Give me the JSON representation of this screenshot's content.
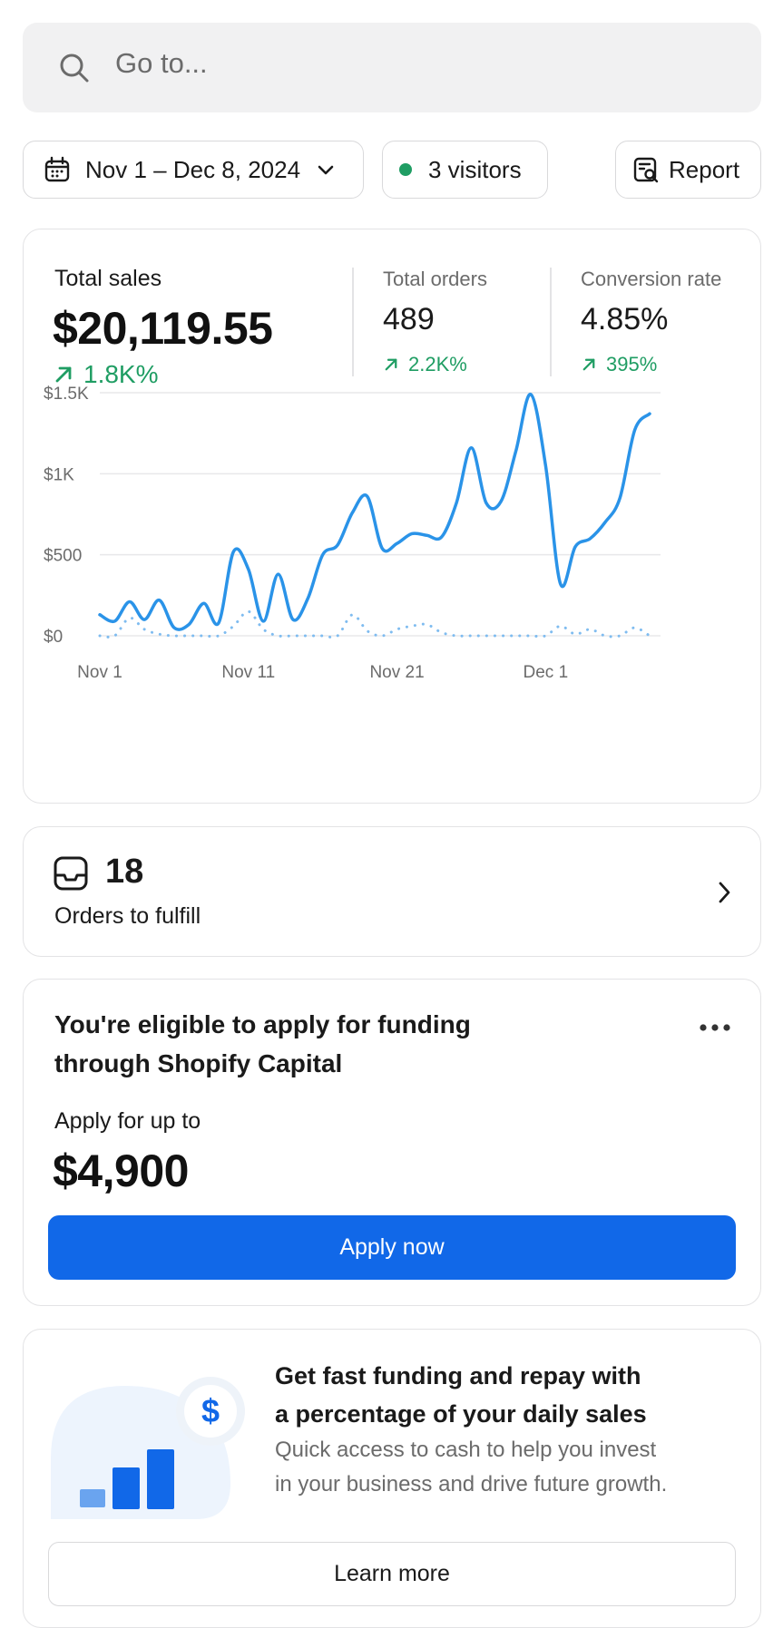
{
  "search": {
    "placeholder": "Go to..."
  },
  "filters": {
    "date_range": "Nov 1 – Dec 8, 2024",
    "visitors": "3 visitors",
    "report": "Report"
  },
  "stats": {
    "total_sales": {
      "label": "Total sales",
      "value": "$20,119.55",
      "change": "1.8K%"
    },
    "total_orders": {
      "label": "Total orders",
      "value": "489",
      "change": "2.2K%"
    },
    "conversion_rate": {
      "label": "Conversion rate",
      "value": "4.85%",
      "change": "395%"
    }
  },
  "chart_data": {
    "type": "line",
    "y_ticks": [
      "$1.5K",
      "$1K",
      "$500",
      "$0"
    ],
    "x_ticks": [
      "Nov 1",
      "Nov 11",
      "Nov 21",
      "Dec 1"
    ],
    "ylim": [
      0,
      1500
    ],
    "grid": true,
    "series": [
      {
        "style": "solid",
        "color": "#2a93e8",
        "x": [
          1,
          2,
          3,
          4,
          5,
          6,
          7,
          8,
          9,
          10,
          11,
          12,
          13,
          14,
          15,
          16,
          17,
          18,
          19,
          20,
          21,
          22,
          23,
          24,
          25,
          26,
          27,
          28,
          29,
          30,
          31,
          32,
          33,
          34,
          35,
          36,
          37,
          38
        ],
        "values": [
          130,
          90,
          210,
          100,
          220,
          50,
          70,
          200,
          80,
          520,
          410,
          90,
          380,
          100,
          230,
          500,
          560,
          760,
          860,
          540,
          570,
          630,
          620,
          610,
          820,
          1160,
          820,
          830,
          1140,
          1490,
          1050,
          320,
          550,
          600,
          700,
          850,
          1270,
          1370
        ]
      },
      {
        "style": "dotted",
        "color": "#7fbcf0",
        "x": [
          1,
          2,
          3,
          4,
          5,
          6,
          7,
          8,
          9,
          10,
          11,
          12,
          13,
          14,
          15,
          16,
          17,
          18,
          19,
          20,
          21,
          22,
          23,
          24,
          25,
          26,
          27,
          28,
          29,
          30,
          31,
          32,
          33,
          34,
          35,
          36,
          37,
          38
        ],
        "values": [
          0,
          0,
          110,
          40,
          10,
          0,
          0,
          0,
          0,
          60,
          150,
          40,
          0,
          0,
          0,
          0,
          0,
          130,
          30,
          0,
          40,
          60,
          70,
          20,
          0,
          0,
          0,
          0,
          0,
          0,
          0,
          60,
          10,
          40,
          0,
          0,
          50,
          0
        ]
      }
    ]
  },
  "orders": {
    "count": "18",
    "label": "Orders to fulfill"
  },
  "funding": {
    "title_line1": "You're eligible to apply for funding",
    "title_line2": "through Shopify Capital",
    "apply_label": "Apply for up to",
    "amount": "$4,900",
    "button": "Apply now"
  },
  "promo": {
    "title_line1": "Get fast funding and repay with",
    "title_line2": "a percentage of your daily sales",
    "desc_line1": "Quick access to cash to help you invest",
    "desc_line2": "in your business and drive future growth.",
    "button": "Learn more",
    "dollar_symbol": "$"
  }
}
